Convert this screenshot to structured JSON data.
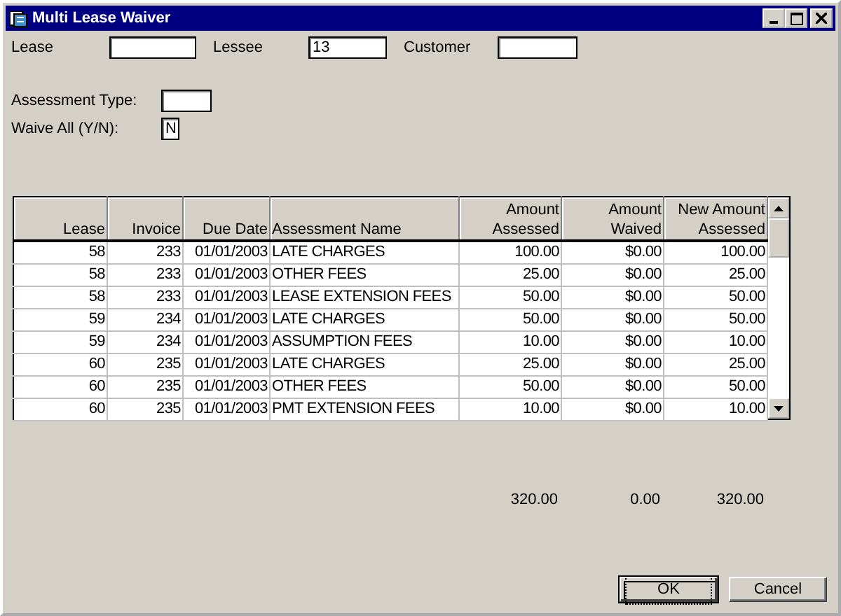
{
  "window": {
    "title": "Multi Lease Waiver"
  },
  "top_fields": [
    {
      "label": "Lease"
    },
    {
      "label": "Lessee",
      "value": "13"
    },
    {
      "label": "Customer"
    }
  ],
  "side_fields": [
    {
      "label": "Assessment Type:"
    },
    {
      "label": "Waive All (Y/N):",
      "value": "N"
    }
  ],
  "table": {
    "columns": [
      "Lease",
      "Invoice",
      "Due Date",
      "Assessment Name",
      "Amount\nAssessed",
      "Amount\nWaived",
      "New Amount\nAssessed"
    ],
    "rows": [
      [
        "58",
        "233",
        "01/01/2003",
        "LATE CHARGES",
        "100.00",
        "$0.00",
        "100.00"
      ],
      [
        "58",
        "233",
        "01/01/2003",
        "OTHER FEES",
        "25.00",
        "$0.00",
        "25.00"
      ],
      [
        "58",
        "233",
        "01/01/2003",
        "LEASE EXTENSION FEES",
        "50.00",
        "$0.00",
        "50.00"
      ],
      [
        "59",
        "234",
        "01/01/2003",
        "LATE CHARGES",
        "50.00",
        "$0.00",
        "50.00"
      ],
      [
        "59",
        "234",
        "01/01/2003",
        "ASSUMPTION FEES",
        "10.00",
        "$0.00",
        "10.00"
      ],
      [
        "60",
        "235",
        "01/01/2003",
        "LATE CHARGES",
        "25.00",
        "$0.00",
        "25.00"
      ],
      [
        "60",
        "235",
        "01/01/2003",
        "OTHER FEES",
        "50.00",
        "$0.00",
        "50.00"
      ],
      [
        "60",
        "235",
        "01/01/2003",
        "PMT EXTENSION FEES",
        "10.00",
        "$0.00",
        "10.00"
      ]
    ]
  },
  "totals": [
    "320.00",
    "0.00",
    "320.00"
  ],
  "buttons": [
    {
      "label": "OK",
      "default": true
    },
    {
      "label": "Cancel",
      "default": false
    }
  ]
}
